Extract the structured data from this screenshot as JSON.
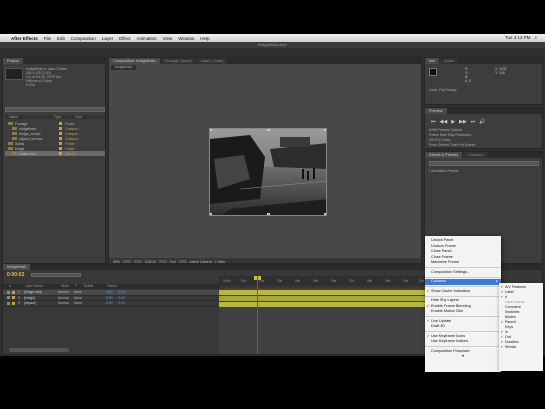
{
  "menubar": {
    "apple": "",
    "app_name": "After Effects",
    "items": [
      "File",
      "Edit",
      "Composition",
      "Layer",
      "Effect",
      "Animation",
      "View",
      "Window",
      "Help"
    ],
    "clock": "Tue 3:13 PM"
  },
  "window_title": "bridgefinish.aep*",
  "project_panel": {
    "tab": "Project",
    "info_lines": [
      "bridgefinish ▾, used 3 times",
      "160 x 120 (1.00)",
      "Δ 0:00:04:10, 29.97 fps",
      "Millions of Colors",
      "H.264"
    ],
    "search_placeholder": "",
    "columns": [
      "Name",
      "Type",
      "Size"
    ],
    "items": [
      {
        "name": "Footage",
        "type": "Folder",
        "selected": false
      },
      {
        "name": "bridgefinish",
        "type": "Compos...",
        "size": "0",
        "selected": false
      },
      {
        "name": "bridge_comp2",
        "type": "Compos...",
        "size": "0",
        "selected": false
      },
      {
        "name": "citysun_bri.mov",
        "type": "Compos...",
        "size": "0",
        "selected": false
      },
      {
        "name": "Solids",
        "type": "Folder",
        "selected": false
      },
      {
        "name": "bridge",
        "type": "Folder",
        "selected": false
      },
      {
        "name": "bridge.mov",
        "type": "QuickT...",
        "size": "40",
        "selected": true
      }
    ],
    "footer_label": "8 bpc"
  },
  "comp_panel": {
    "tabs": [
      "Composition: bridgefinish",
      "Footage: (none)",
      "Layer: (none)"
    ],
    "sub_tab": "bridgefinish",
    "zoom": "50%",
    "resolution": "Full",
    "camera": "Active Camera",
    "views": "1 View"
  },
  "info_panel": {
    "tabs": [
      "Info",
      "Audio"
    ],
    "values": [
      "R:",
      "G:",
      "B:",
      "A: 0"
    ],
    "coords": [
      "X: 1158",
      "Y: 108"
    ],
    "label": "Color: Fuji Orange"
  },
  "preview_panel": {
    "tabs": [
      "Preview"
    ],
    "controls": [
      "⏮",
      "◀◀",
      "▶",
      "▶▶",
      "⏭",
      "🔊"
    ],
    "ram_label": "RAM Preview Options",
    "frame_rate": "Frame Rate  Skip  Resolution",
    "values": "(29.97)   0   Auto",
    "from": "From Current Time   Full Screen"
  },
  "effects_panel": {
    "tabs": [
      "Effects & Presets",
      "Character"
    ],
    "search_placeholder": "",
    "item": "* Animation Presets"
  },
  "timeline": {
    "tab": "bridgefinish",
    "timecode": "0:00:02",
    "columns": [
      "#",
      "Layer Name",
      "Mode",
      "T",
      "TrkMat",
      "Parent"
    ],
    "layers": [
      {
        "num": "1",
        "name": "[bridge.mov]",
        "mode": "Normal",
        "parent": "None",
        "t1": "0:00",
        "t2": "0:04",
        "color": "#c8a050",
        "selected": true
      },
      {
        "num": "2",
        "name": "[bridge]",
        "mode": "Normal",
        "parent": "None",
        "t1": "0:00",
        "t2": "0:04",
        "color": "#c8a050",
        "selected": false
      },
      {
        "num": "3",
        "name": "[citysun]",
        "mode": "Normal",
        "parent": "None",
        "t1": "0:00",
        "t2": "0:04",
        "color": "#c8a050",
        "selected": false
      }
    ],
    "ruler_ticks": [
      "0:00s",
      "01s",
      "02s",
      "03s",
      "04s",
      "05s",
      "06s",
      "07s",
      "08s",
      "09s",
      "10s",
      "11s"
    ]
  },
  "context_menu": {
    "items": [
      {
        "label": "Unlock Panel",
        "check": false
      },
      {
        "label": "Undock Frame",
        "check": false
      },
      {
        "label": "Close Panel",
        "check": false
      },
      {
        "label": "Close Frame",
        "check": false
      },
      {
        "label": "Maximize Frame",
        "check": false
      },
      {
        "sep": true
      },
      {
        "label": "Composition Settings...",
        "check": false
      },
      {
        "sep": true
      },
      {
        "label": "Columns",
        "check": false,
        "highlighted": true,
        "submenu": true
      },
      {
        "sep": true
      },
      {
        "label": "Show Cache Indicators",
        "check": true
      },
      {
        "sep": true
      },
      {
        "label": "Hide Shy Layers",
        "check": false
      },
      {
        "label": "Enable Frame Blending",
        "check": true
      },
      {
        "label": "Enable Motion Blur",
        "check": false
      },
      {
        "sep": true
      },
      {
        "label": "Live Update",
        "check": true
      },
      {
        "label": "Draft 3D",
        "check": false
      },
      {
        "sep": true
      },
      {
        "label": "Use Keyframe Icons",
        "check": true
      },
      {
        "label": "Use Keyframe Indices",
        "check": false
      },
      {
        "sep": true
      },
      {
        "label": "Composition Flowchart",
        "check": false
      },
      {
        "label": "▾",
        "check": false
      }
    ]
  },
  "sub_menu": {
    "items": [
      {
        "label": "A/V Features",
        "check": true
      },
      {
        "label": "Label",
        "check": true
      },
      {
        "label": "#",
        "check": true
      },
      {
        "label": "Layer Name",
        "check": false,
        "disabled": true
      },
      {
        "label": "Comment",
        "check": false
      },
      {
        "label": "Switches",
        "check": false
      },
      {
        "label": "Modes",
        "check": false
      },
      {
        "label": "Parent",
        "check": true
      },
      {
        "label": "Keys",
        "check": false
      },
      {
        "label": "In",
        "check": true
      },
      {
        "label": "Out",
        "check": true
      },
      {
        "label": "Duration",
        "check": true
      },
      {
        "label": "Stretch",
        "check": true
      }
    ]
  }
}
